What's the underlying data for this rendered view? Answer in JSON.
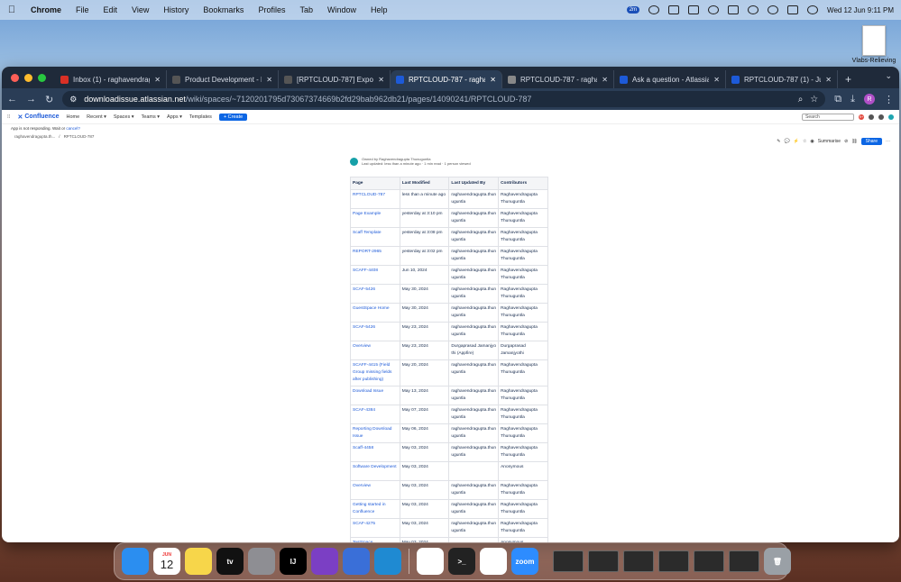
{
  "menubar": {
    "app": "Chrome",
    "items": [
      "File",
      "Edit",
      "View",
      "History",
      "Bookmarks",
      "Profiles",
      "Tab",
      "Window",
      "Help"
    ],
    "status_badge": "2m",
    "datetime": "Wed 12 Jun  9:11 PM"
  },
  "desktop": {
    "file_label": "Vlabs-Relieving"
  },
  "browser": {
    "tabs": [
      {
        "label": "Inbox (1) - raghavendrag",
        "icon": "gmail-icon",
        "color": "#d93025"
      },
      {
        "label": "Product Development - R",
        "icon": "atlassian-icon",
        "color": "#555555"
      },
      {
        "label": "[RPTCLOUD-787] Export",
        "icon": "atlassian-icon",
        "color": "#555555"
      },
      {
        "label": "RPTCLOUD-787 - raghav",
        "icon": "confluence-icon",
        "color": "#1d5ad8"
      },
      {
        "label": "RPTCLOUD-787 - raghav",
        "icon": "globe-icon",
        "color": "#888888"
      },
      {
        "label": "Ask a question - Atlassia",
        "icon": "atlassian-icon",
        "color": "#1d5ad8"
      },
      {
        "label": "RPTCLOUD-787 (1) - Jun",
        "icon": "doc-icon",
        "color": "#1d5ad8"
      }
    ],
    "url_host": "downloadissue.atlassian.net",
    "url_path": "/wiki/spaces/~7120201795d73067374669b2fd29bab962db21/pages/14090241/RPTCLOUD-787",
    "profile_initial": "R"
  },
  "confluence": {
    "logo": "Confluence",
    "nav": [
      "Home",
      "Recent ▾",
      "Spaces ▾",
      "Teams ▾",
      "Apps ▾",
      "Templates"
    ],
    "create": "+ Create",
    "search_placeholder": "Search",
    "notif_count": "9+",
    "notice_text": "App is not responding. Wait or",
    "notice_link": "cancel?",
    "breadcrumb_space": "raghavendragupta.th...",
    "breadcrumb_page": "RPTCLOUD-787",
    "summarise": "Summarise",
    "share": "Share",
    "owner_line": "Owned by Raghavendragupta Thunuguntla",
    "meta_line": "Last updated: less than a minute ago  ·  1 min read  ·  1 person viewed",
    "table": {
      "headers": [
        "Page",
        "Last Modified",
        "Last Updated By",
        "Contributors"
      ],
      "rows": [
        [
          "RPTCLOUD-787",
          "less than a minute ago",
          "raghavendragupta.thunuguntla",
          "Raghavendragupta Thunuguntla"
        ],
        [
          "Page Example",
          "yesterday at 3:10 pm",
          "raghavendragupta.thunuguntla",
          "Raghavendragupta Thunuguntla"
        ],
        [
          "Scaff Template",
          "yesterday at 3:08 pm",
          "raghavendragupta.thunuguntla",
          "Raghavendragupta Thunuguntla"
        ],
        [
          "REPORT-2965",
          "yesterday at 3:02 pm",
          "raghavendragupta.thunuguntla",
          "Raghavendragupta Thunuguntla"
        ],
        [
          "SCAFF-4408",
          "Jun 10, 2024",
          "raghavendragupta.thunuguntla",
          "Raghavendragupta Thunuguntla"
        ],
        [
          "SCAF-5426",
          "May 30, 2024",
          "raghavendragupta.thunuguntla",
          "Raghavendragupta Thunuguntla"
        ],
        [
          "GuestSpace Home",
          "May 30, 2024",
          "raghavendragupta.thunuguntla",
          "Raghavendragupta Thunuguntla"
        ],
        [
          "SCAF-5426",
          "May 23, 2024",
          "raghavendragupta.thunuguntla",
          "Raghavendragupta Thunuguntla"
        ],
        [
          "Overview",
          "May 23, 2024",
          "Durgaprasad Jamanjyothi (Appfire)",
          "Durgaprasad Jamanjyothi"
        ],
        [
          "SCAFF-4415 (Field Group missing fields after publishing)",
          "May 20, 2024",
          "raghavendragupta.thunuguntla",
          "Raghavendragupta Thunuguntla"
        ],
        [
          "Download Issue",
          "May 13, 2024",
          "raghavendragupta.thunuguntla",
          "Raghavendragupta Thunuguntla"
        ],
        [
          "SCAF-4384",
          "May 07, 2024",
          "raghavendragupta.thunuguntla",
          "Raghavendragupta Thunuguntla"
        ],
        [
          "Reporting Download Issue",
          "May 06, 2024",
          "raghavendragupta.thunuguntla",
          "Raghavendragupta Thunuguntla"
        ],
        [
          "Scaff-4458",
          "May 03, 2024",
          "raghavendragupta.thunuguntla",
          "Raghavendragupta Thunuguntla"
        ],
        [
          "Software Development",
          "May 03, 2024",
          "",
          "Anonymous"
        ],
        [
          "Overview",
          "May 03, 2024",
          "raghavendragupta.thunuguntla",
          "Raghavendragupta Thunuguntla"
        ],
        [
          "Getting started in Confluence",
          "May 03, 2024",
          "raghavendragupta.thunuguntla",
          "Raghavendragupta Thunuguntla"
        ],
        [
          "SCAF-4275",
          "May 03, 2024",
          "raghavendragupta.thunuguntla",
          "Raghavendragupta Thunuguntla"
        ],
        [
          "TestSpace",
          "May 03, 2024",
          "",
          "Anonymous"
        ]
      ]
    }
  },
  "dock": {
    "calendar_month": "JUN",
    "calendar_day": "12",
    "apps": [
      {
        "name": "finder",
        "label": "",
        "color": "#2b8ef0"
      },
      {
        "name": "calendar",
        "label": "",
        "color": "#ffffff"
      },
      {
        "name": "notes",
        "label": "",
        "color": "#f7d64a"
      },
      {
        "name": "apple-tv",
        "label": "tv",
        "color": "#111111"
      },
      {
        "name": "system-settings",
        "label": "",
        "color": "#8e8e93"
      },
      {
        "name": "intellij",
        "label": "IJ",
        "color": "#000000"
      },
      {
        "name": "github-desktop",
        "label": "",
        "color": "#7b3fc4"
      },
      {
        "name": "proxyman",
        "label": "",
        "color": "#3a6fd8"
      },
      {
        "name": "vscode",
        "label": "",
        "color": "#1f8ad2"
      },
      {
        "name": "slack",
        "label": "",
        "color": "#ffffff"
      },
      {
        "name": "terminal",
        "label": ">_",
        "color": "#222222"
      },
      {
        "name": "chrome",
        "label": "",
        "color": "#ffffff"
      },
      {
        "name": "zoom",
        "label": "zoom",
        "color": "#2d8cff"
      }
    ]
  }
}
